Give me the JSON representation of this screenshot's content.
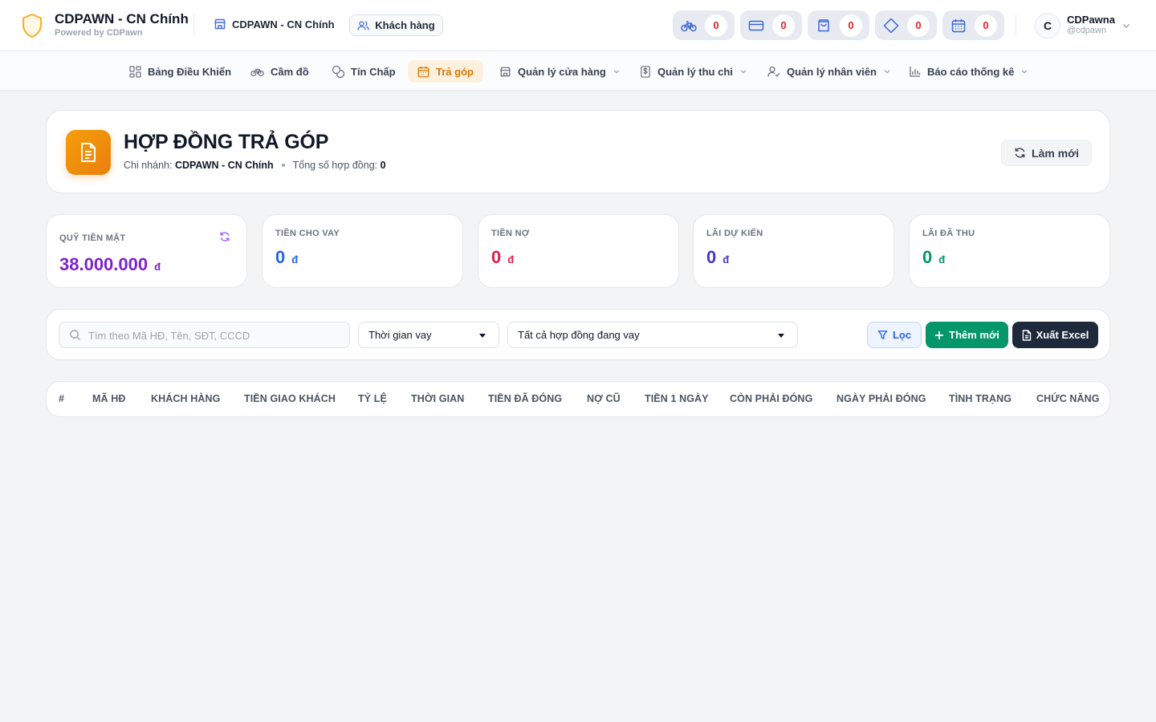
{
  "brand": {
    "name": "CDPAWN - CN Chính",
    "subtitle": "Powered by CDPawn"
  },
  "branch": {
    "label": "CDPAWN - CN Chính"
  },
  "customers_button": {
    "label": "Khách hàng"
  },
  "counters": [
    {
      "icon": "bicycle-icon",
      "value": "0"
    },
    {
      "icon": "credit-card-icon",
      "value": "0"
    },
    {
      "icon": "shopping-bag-icon",
      "value": "0"
    },
    {
      "icon": "diamond-icon",
      "value": "0"
    },
    {
      "icon": "calendar-icon",
      "value": "0"
    }
  ],
  "user": {
    "initial": "C",
    "name": "CDPawna",
    "handle": "@cdpawn"
  },
  "nav": {
    "dashboard": "Bảng Điều Khiển",
    "pawn": "Cầm đồ",
    "credit": "Tín Chấp",
    "installment": "Trả góp",
    "store": "Quản lý cửa hàng",
    "income_expense": "Quản lý thu chi",
    "staff": "Quản lý nhân viên",
    "reports": "Báo cáo thống kê"
  },
  "header": {
    "title": "HỢP ĐỒNG TRẢ GÓP",
    "branch_label": "Chi nhánh:",
    "branch_value": "CDPAWN - CN Chính",
    "total_label": "Tổng số hợp đồng:",
    "total_value": "0",
    "refresh_label": "Làm mới"
  },
  "stats": {
    "cash": {
      "label": "QUỸ TIỀN MẶT",
      "value": "38.000.000",
      "currency": "đ",
      "color": "#7e22ce"
    },
    "lent": {
      "label": "TIỀN CHO VAY",
      "value": "0",
      "currency": "đ",
      "color": "#2563eb"
    },
    "debt": {
      "label": "TIỀN NỢ",
      "value": "0",
      "currency": "đ",
      "color": "#e11d48"
    },
    "expected_interest": {
      "label": "LÃI DỰ KIẾN",
      "value": "0",
      "currency": "đ",
      "color": "#4338ca"
    },
    "collected_interest": {
      "label": "LÃI ĐÃ THU",
      "value": "0",
      "currency": "đ",
      "color": "#059669"
    }
  },
  "filters": {
    "search_placeholder": "Tìm theo Mã HĐ, Tên, SĐT, CCCD",
    "time_select": "Thời gian vay",
    "status_select": "Tất cả hợp đồng đang vay",
    "filter_button": "Lọc",
    "add_button": "Thêm mới",
    "export_button": "Xuất Excel"
  },
  "table": {
    "columns": [
      "#",
      "MÃ HĐ",
      "KHÁCH HÀNG",
      "TIỀN GIAO KHÁCH",
      "TỶ LỆ",
      "THỜI GIAN",
      "TIỀN ĐÃ ĐÓNG",
      "NỢ CŨ",
      "TIỀN 1 NGÀY",
      "CÒN PHẢI ĐÓNG",
      "NGÀY PHẢI ĐÓNG",
      "TÌNH TRẠNG",
      "CHỨC NĂNG"
    ]
  },
  "colors": {
    "accent": "#f59e0b",
    "active_nav": "#d97706",
    "primary_blue": "#2563eb",
    "success": "#059669",
    "dark": "#1e293b"
  }
}
